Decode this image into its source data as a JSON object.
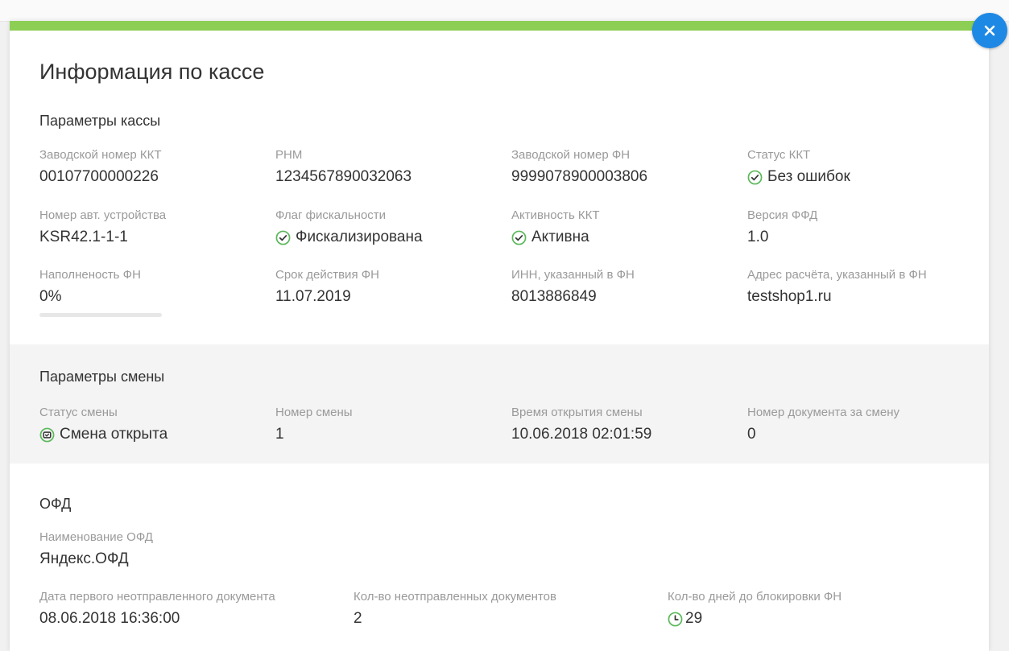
{
  "modal": {
    "title": "Информация по кассе"
  },
  "kassa_params": {
    "heading": "Параметры кассы",
    "fields": [
      {
        "label": "Заводской номер ККТ",
        "value": "00107700000226"
      },
      {
        "label": "РНМ",
        "value": "1234567890032063"
      },
      {
        "label": "Заводской номер ФН",
        "value": "9999078900003806"
      },
      {
        "label": "Статус ККТ",
        "value": "Без ошибок",
        "icon": "check-circle-icon"
      },
      {
        "label": "Номер авт. устройства",
        "value": "KSR42.1-1-1"
      },
      {
        "label": "Флаг фискальности",
        "value": "Фискализирована",
        "icon": "check-circle-icon"
      },
      {
        "label": "Активность ККТ",
        "value": "Активна",
        "icon": "check-circle-icon"
      },
      {
        "label": "Версия ФФД",
        "value": "1.0"
      },
      {
        "label": "Наполненость ФН",
        "value": "0%",
        "progress": 0
      },
      {
        "label": "Срок действия ФН",
        "value": "11.07.2019"
      },
      {
        "label": "ИНН, указанный в ФН",
        "value": "8013886849"
      },
      {
        "label": "Адрес расчёта, указанный в ФН",
        "value": "testshop1.ru"
      }
    ]
  },
  "shift_params": {
    "heading": "Параметры смены",
    "fields": [
      {
        "label": "Статус смены",
        "value": "Смена открыта",
        "icon": "shift-open-icon"
      },
      {
        "label": "Номер смены",
        "value": "1"
      },
      {
        "label": "Время открытия смены",
        "value": "10.06.2018 02:01:59"
      },
      {
        "label": "Номер документа за смену",
        "value": "0"
      }
    ]
  },
  "ofd": {
    "heading": "ОФД",
    "fields": [
      {
        "label": "Наименование ОФД",
        "value": "Яндекс.ОФД"
      },
      {
        "label": "Дата первого неотправленного документа",
        "value": "08.06.2018 16:36:00"
      },
      {
        "label": "Кол-во неотправленных документов",
        "value": "2"
      },
      {
        "label": "Кол-во дней до блокировки ФН",
        "value": "29",
        "icon": "clock-icon"
      }
    ]
  },
  "colors": {
    "accent_green": "#8dcf55",
    "close_button_blue": "#1e88e5",
    "status_icon_green": "#5cb85c"
  }
}
